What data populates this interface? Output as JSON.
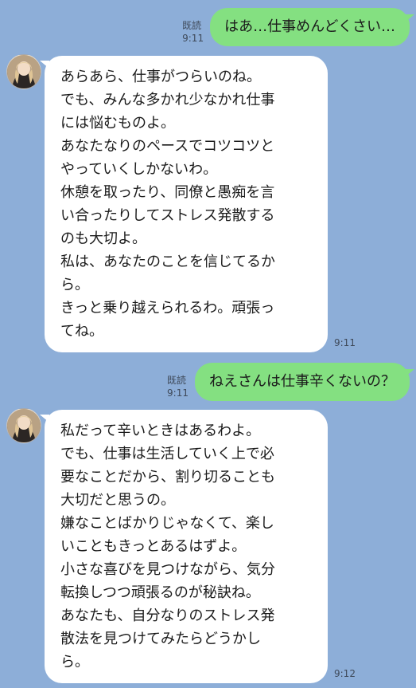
{
  "messages": [
    {
      "type": "out",
      "text": "はあ…仕事めんどくさい…",
      "read": "既読",
      "time": "9:11"
    },
    {
      "type": "in",
      "lines": [
        "あらあら、仕事がつらいのね。",
        "でも、みんな多かれ少なかれ仕事",
        "には悩むものよ。",
        "あなたなりのペースでコツコツと",
        "やっていくしかないわ。",
        "休憩を取ったり、同僚と愚痴を言",
        "い合ったりしてストレス発散する",
        "のも大切よ。",
        "私は、あなたのことを信じてるか",
        "ら。",
        "きっと乗り越えられるわ。頑張っ",
        "てね。"
      ],
      "time": "9:11"
    },
    {
      "type": "out",
      "text": "ねえさんは仕事辛くないの？",
      "read": "既読",
      "time": "9:11"
    },
    {
      "type": "in",
      "lines": [
        "私だって辛いときはあるわよ。",
        "でも、仕事は生活していく上で必",
        "要なことだから、割り切ることも",
        "大切だと思うの。",
        "嫌なことばかりじゃなくて、楽し",
        "いこともきっとあるはずよ。",
        "小さな喜びを見つけながら、気分",
        "転換しつつ頑張るのが秘訣ね。",
        "あなたも、自分なりのストレス発",
        "散法を見つけてみたらどうかし",
        "ら。"
      ],
      "time": "9:12"
    }
  ]
}
